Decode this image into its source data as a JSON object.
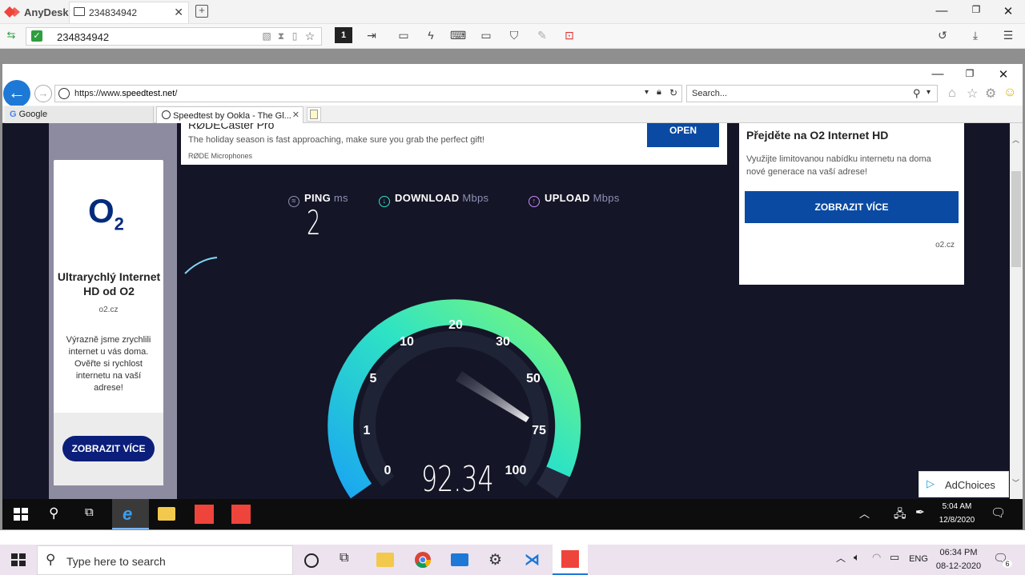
{
  "anydesk": {
    "app_name": "AnyDesk",
    "tab_label": "234834942",
    "address_value": "234834942"
  },
  "ie": {
    "url_prefix": "https://www.",
    "url_domain": "speedtest.net",
    "url_suffix": "/",
    "search_placeholder": "Search...",
    "tabs": [
      {
        "label": "Google"
      },
      {
        "label": "Speedtest by Ookla - The Gl..."
      }
    ]
  },
  "ads": {
    "rode": {
      "title": "RØDECaster Pro",
      "subtitle": "The holiday season is fast approaching, make sure you grab the perfect gift!",
      "brand": "RØDE Microphones",
      "button": "OPEN"
    },
    "o2_left": {
      "logo": "O",
      "logo_sub": "2",
      "title": "Ultrarychlý Internet HD od O2",
      "domain": "o2.cz",
      "text": "Výrazně jsme zrychlili internet u vás doma. Ověřte si rychlost internetu na vaší adrese!",
      "button": "ZOBRAZIT VÍCE"
    },
    "o2_right": {
      "title": "Přejděte na O2 Internet HD",
      "text": "Využijte limitovanou nabídku internetu na doma nové generace na vaší adrese!",
      "button": "ZOBRAZIT VÍCE",
      "domain": "o2.cz"
    },
    "adchoices": "AdChoices"
  },
  "speedtest": {
    "ping_label": "PING",
    "ping_unit": "ms",
    "download_label": "DOWNLOAD",
    "download_unit": "Mbps",
    "upload_label": "UPLOAD",
    "upload_unit": "Mbps",
    "ping_value": "2",
    "current_speed": "92.34",
    "gauge_ticks": [
      "0",
      "1",
      "5",
      "10",
      "20",
      "30",
      "50",
      "75",
      "100"
    ],
    "colors": {
      "gauge_start": "#1ba7f0",
      "gauge_mid": "#2ee3c4",
      "gauge_end": "#7cf67a",
      "background": "#141526"
    }
  },
  "remote_taskbar": {
    "time": "5:04 AM",
    "date": "12/8/2020"
  },
  "local_taskbar": {
    "search_placeholder": "Type here to search",
    "language": "ENG",
    "time": "06:34 PM",
    "date": "08-12-2020",
    "notifications": "6"
  }
}
